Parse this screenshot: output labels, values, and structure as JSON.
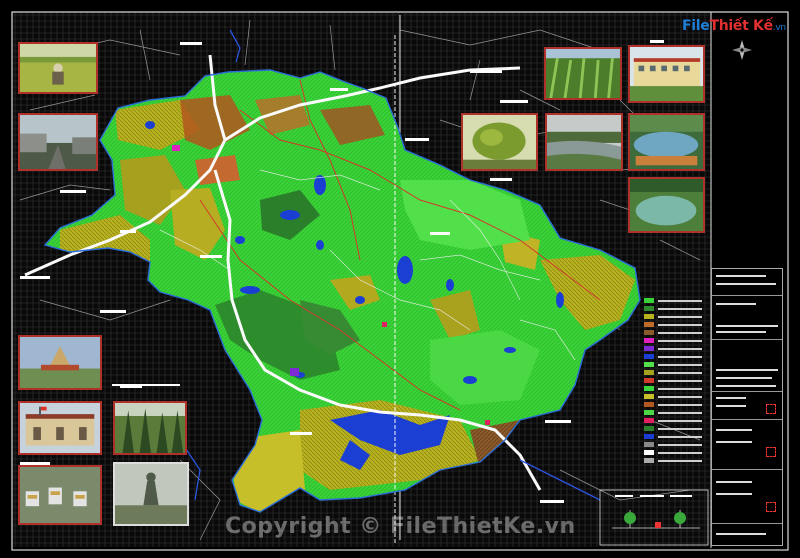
{
  "logo": {
    "brand_main": "File",
    "brand_second": "Thiết Kế",
    "tld": ".vn"
  },
  "watermark": {
    "text": "Copyright © FileThietKe.vn"
  },
  "colors": {
    "background": "#000000",
    "agriculture_green": "#3cd63c",
    "forest_dark_green": "#2e8b2e",
    "yellow_olive": "#b8b020",
    "water_blue": "#1a3cd0",
    "road": "#ffffff",
    "photo_border": "#b0302a"
  },
  "photos": [
    {
      "name": "photo-rice-farmer",
      "theme": "rice field with farmer"
    },
    {
      "name": "photo-town-street",
      "theme": "town street"
    },
    {
      "name": "photo-corn-field",
      "theme": "corn field"
    },
    {
      "name": "photo-school-building",
      "theme": "school building"
    },
    {
      "name": "photo-green-tree",
      "theme": "green tree"
    },
    {
      "name": "photo-river",
      "theme": "river"
    },
    {
      "name": "photo-lake-resort",
      "theme": "lake resort"
    },
    {
      "name": "photo-pond",
      "theme": "pond"
    },
    {
      "name": "photo-monument",
      "theme": "monument"
    },
    {
      "name": "photo-market-building",
      "theme": "market building"
    },
    {
      "name": "photo-pine-forest",
      "theme": "pine forest"
    },
    {
      "name": "photo-cemetery",
      "theme": "cemetery"
    },
    {
      "name": "photo-statue",
      "theme": "statue"
    }
  ],
  "icons": [
    "compass-icon"
  ]
}
